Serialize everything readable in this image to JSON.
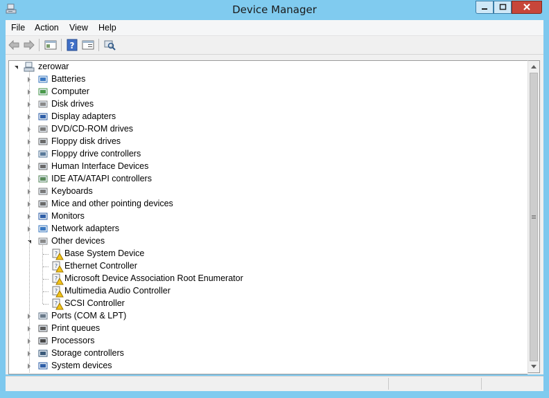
{
  "window": {
    "title": "Device Manager",
    "accent_color": "#80cbef",
    "close_color": "#c7463a"
  },
  "menu": {
    "items": [
      "File",
      "Action",
      "View",
      "Help"
    ]
  },
  "toolbar": {
    "buttons": [
      "back-icon",
      "forward-icon",
      "show-hide-console-tree-icon",
      "help-icon",
      "properties-icon",
      "scan-hardware-changes-icon"
    ]
  },
  "tree": {
    "root": "zerowar",
    "categories": [
      "Batteries",
      "Computer",
      "Disk drives",
      "Display adapters",
      "DVD/CD-ROM drives",
      "Floppy disk drives",
      "Floppy drive controllers",
      "Human Interface Devices",
      "IDE ATA/ATAPI controllers",
      "Keyboards",
      "Mice and other pointing devices",
      "Monitors",
      "Network adapters",
      "Other devices"
    ],
    "other_devices": [
      "Base System Device",
      "Ethernet Controller",
      "Microsoft Device Association Root Enumerator",
      "Multimedia Audio Controller",
      "SCSI Controller"
    ],
    "categories_after": [
      "Ports (COM & LPT)",
      "Print queues",
      "Processors",
      "Storage controllers",
      "System devices"
    ]
  }
}
